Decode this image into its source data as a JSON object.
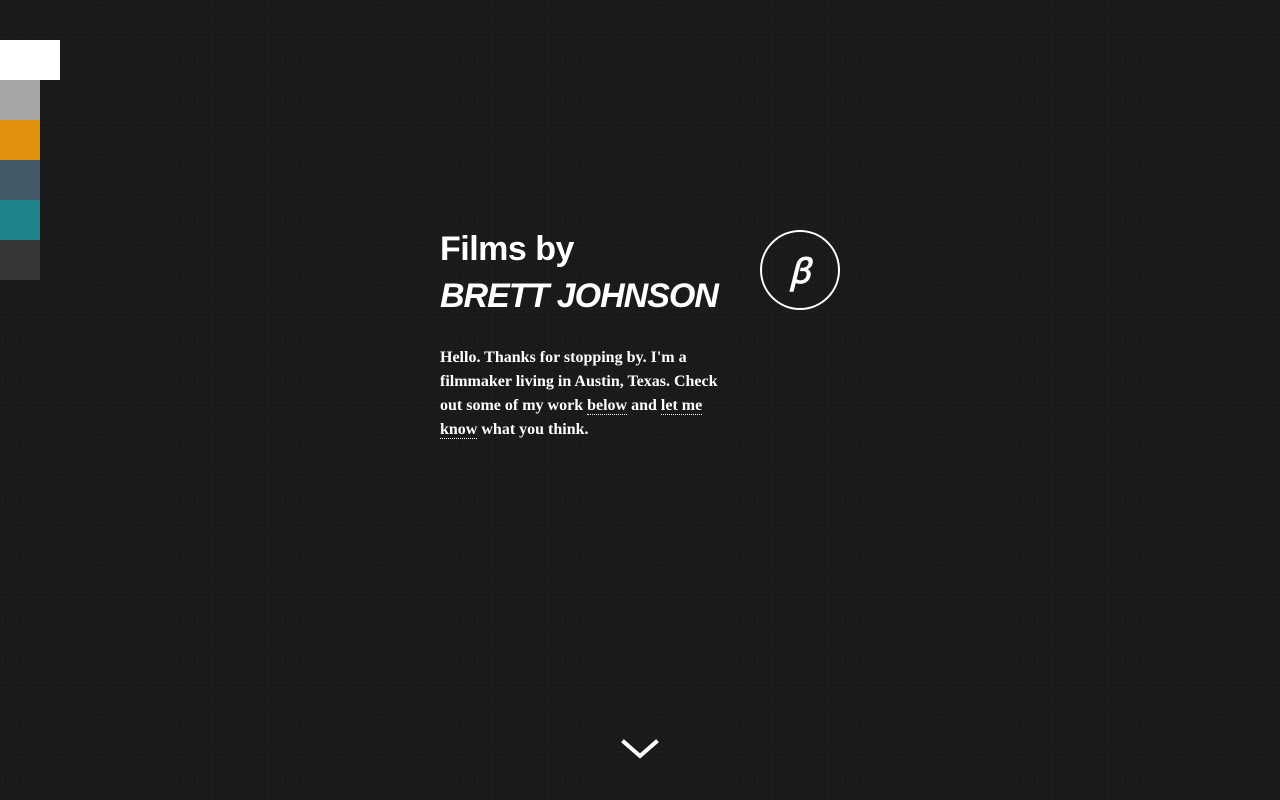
{
  "swatches": [
    {
      "color": "#ffffff",
      "active": true
    },
    {
      "color": "#a6a6a6",
      "active": false
    },
    {
      "color": "#e0920e",
      "active": false
    },
    {
      "color": "#455a68",
      "active": false
    },
    {
      "color": "#21838d",
      "active": false
    },
    {
      "color": "#363636",
      "active": false
    }
  ],
  "header": {
    "title_line1": "Films by",
    "title_line2": "BRETT JOHNSON",
    "monogram": "ꞵ"
  },
  "bio": {
    "text_before": "Hello. Thanks for stopping by. I'm a filmmaker living in Austin, Texas. Check out some of my work ",
    "link_below": "below",
    "text_middle": " and ",
    "link_contact": "let me know",
    "text_after": " what you think."
  },
  "scroll": {
    "icon": "chevron-down-icon"
  }
}
